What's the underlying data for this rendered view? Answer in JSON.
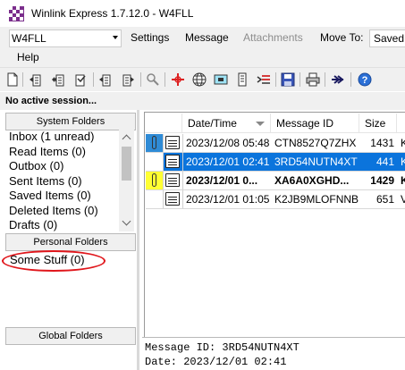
{
  "window": {
    "title": "Winlink Express 1.7.12.0 - W4FLL",
    "icon": "checkered-flag-icon"
  },
  "menubar": {
    "callsign": "W4FLL",
    "items": [
      "Settings",
      "Message",
      "Attachments",
      "Move To:"
    ],
    "disabled_item": "Attachments",
    "move_to_value": "Saved",
    "help": "Help"
  },
  "toolbar": {
    "buttons": [
      "new-message-icon",
      "reply-icon",
      "reply-all-icon",
      "forward-icon",
      "print-message-icon",
      "delete-icon",
      "search-icon",
      "position-report-icon",
      "globe-icon",
      "radio-icon",
      "contacts-icon",
      "templates-icon",
      "save-icon",
      "printer-icon",
      "send-receive-icon",
      "help-icon"
    ]
  },
  "status": {
    "text": "No active session..."
  },
  "system_folders": {
    "header": "System Folders",
    "items": [
      "Inbox  (1 unread)",
      "Read Items  (0)",
      "Outbox  (0)",
      "Sent Items  (0)",
      "Saved Items  (0)",
      "Deleted Items  (0)",
      "Drafts  (0)"
    ]
  },
  "personal_folders": {
    "header": "Personal Folders",
    "items": [
      "Some Stuff  (0)"
    ]
  },
  "global_folders": {
    "header": "Global Folders"
  },
  "message_list": {
    "columns": [
      "Date/Time",
      "Message ID",
      "Size"
    ],
    "rows": [
      {
        "flagged": true,
        "flag_color": "#2f8bd6",
        "datetime": "2023/12/08 05:48",
        "message_id": "CTN8527Q7ZHX",
        "size": "1431",
        "extra": "K",
        "bold": false,
        "selected": false
      },
      {
        "flagged": false,
        "flag_color": "#ffffff",
        "datetime": "2023/12/01 02:41",
        "message_id": "3RD54NUTN4XT",
        "size": "441",
        "extra": "K",
        "bold": false,
        "selected": true
      },
      {
        "flagged": true,
        "flag_color": "#ffff33",
        "datetime": "2023/12/01 0...",
        "message_id": "XA6A0XGHD...",
        "size": "1429",
        "extra": "K",
        "bold": true,
        "selected": false
      },
      {
        "flagged": false,
        "flag_color": "#ffffff",
        "datetime": "2023/12/01 01:05",
        "message_id": "K2JB9MLOFNNB",
        "size": "651",
        "extra": "V",
        "bold": false,
        "selected": false
      }
    ]
  },
  "preview": {
    "message_id": "Message ID: 3RD54NUTN4XT",
    "date": "Date: 2023/12/01 02:41"
  }
}
